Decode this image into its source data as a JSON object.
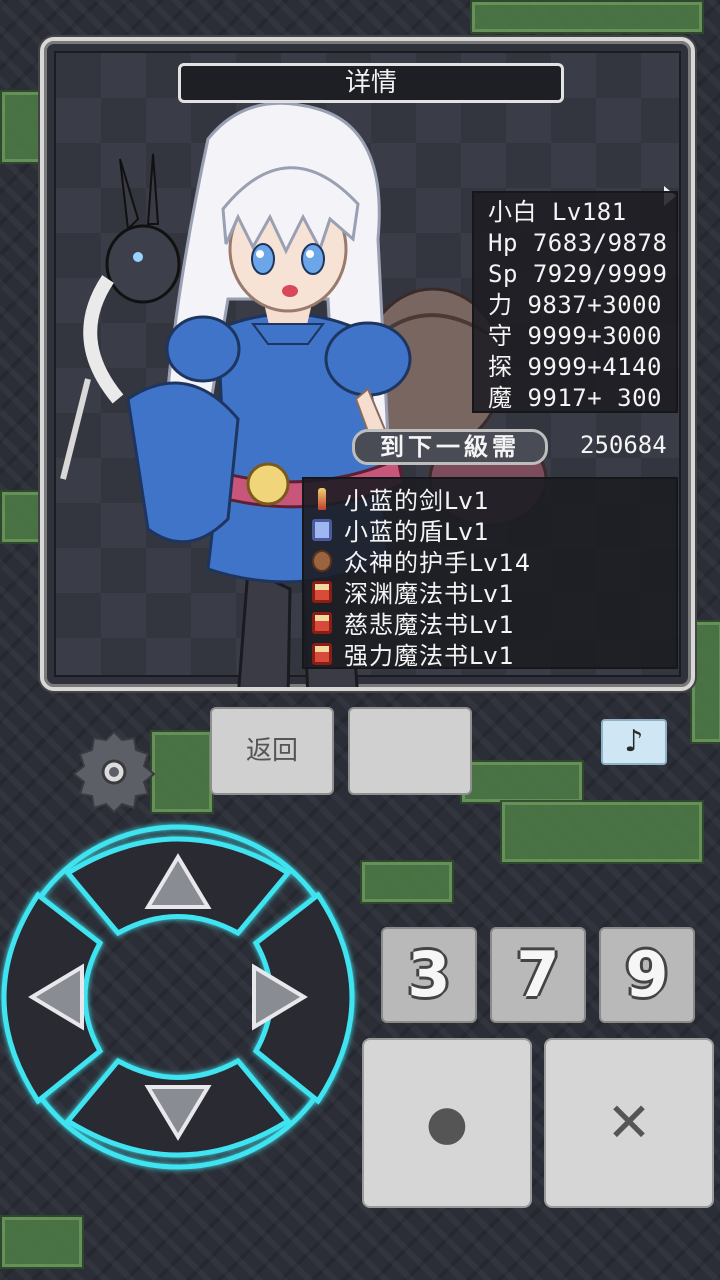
{
  "panel": {
    "title": "详情"
  },
  "stats": {
    "name_level": "小白 Lv181",
    "hp": "Hp 7683/9878",
    "sp": "Sp 7929/9999",
    "power": "力 9837+3000",
    "defense": "守 9999+3000",
    "explore": "探 9999+4140",
    "magic": "魔 9917+ 300"
  },
  "next_level": {
    "label": "到下一級需",
    "value": "250684"
  },
  "equipment": [
    {
      "icon": "sword-icon",
      "name": "小蓝的剑Lv1"
    },
    {
      "icon": "shield-icon",
      "name": "小蓝的盾Lv1"
    },
    {
      "icon": "gauntlet-icon",
      "name": "众神的护手Lv14"
    },
    {
      "icon": "spellbook-icon",
      "name": "深渊魔法书Lv1"
    },
    {
      "icon": "spellbook-icon",
      "name": "慈悲魔法书Lv1"
    },
    {
      "icon": "spellbook-icon",
      "name": "强力魔法书Lv1"
    }
  ],
  "controls": {
    "back_label": "返回",
    "music_icon": "♪",
    "num_buttons": [
      "3",
      "7",
      "9"
    ],
    "confirm_icon": "●",
    "cancel_icon": "✕"
  },
  "colors": {
    "dpad_glow": "#3fe3f0",
    "panel_border": "#d8d8d8",
    "music_button": "#cfe6f4"
  }
}
